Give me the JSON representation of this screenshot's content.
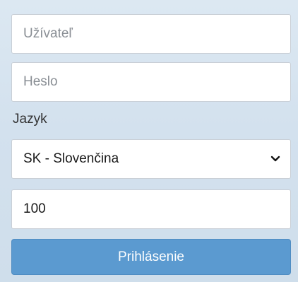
{
  "login": {
    "username_placeholder": "Užívateľ",
    "password_placeholder": "Heslo",
    "language_label": "Jazyk",
    "language_selected": "SK - Slovenčina",
    "number_value": "100",
    "submit_label": "Prihlásenie"
  },
  "icons": {
    "select": "chevron-down-icon"
  },
  "colors": {
    "button": "#5b9ad0",
    "background": "#d3e1ee"
  }
}
